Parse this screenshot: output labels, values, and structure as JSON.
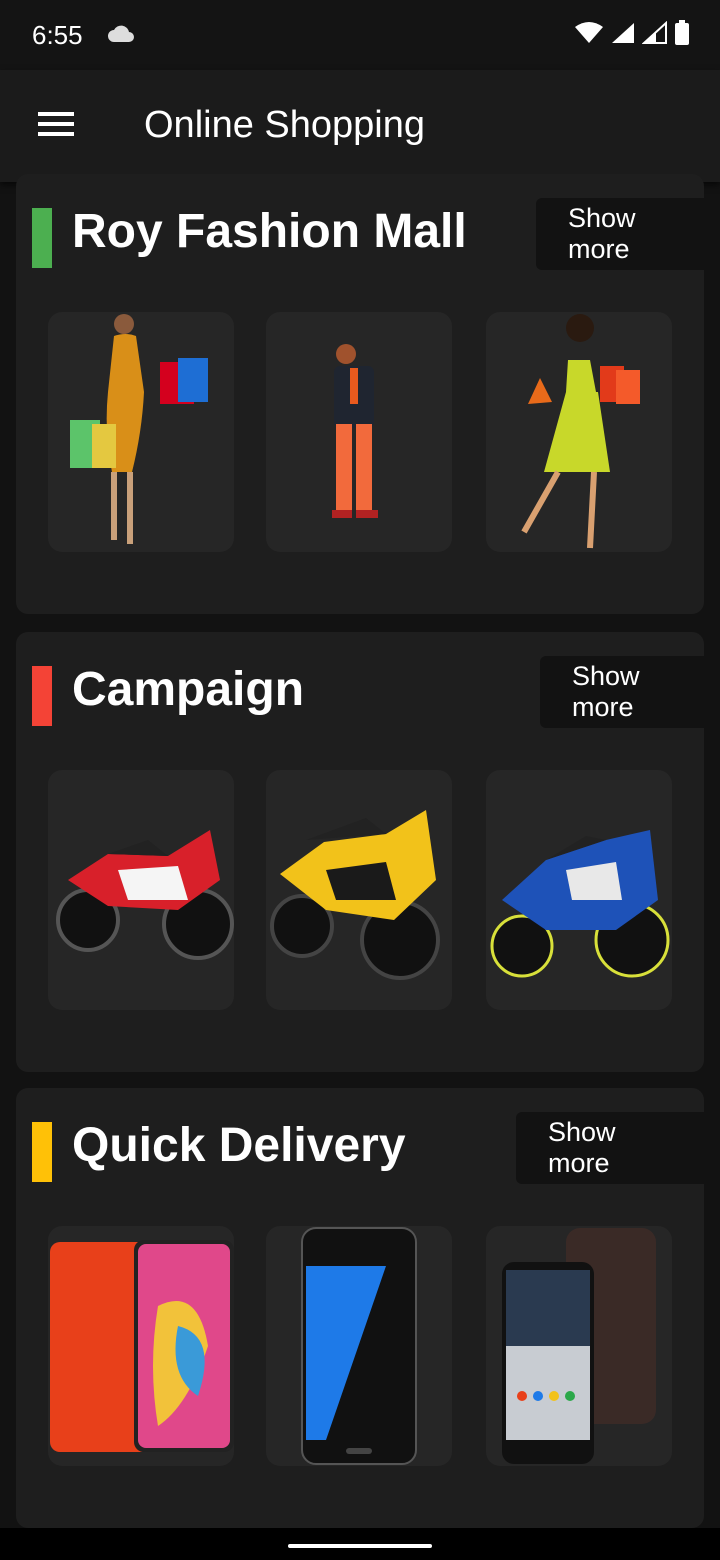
{
  "status": {
    "time": "6:55"
  },
  "app": {
    "title": "Online Shopping"
  },
  "sections": [
    {
      "title": "Roy Fashion Mall",
      "accent": "#4caf50",
      "more_label": "Show more",
      "items": [
        "woman-with-bags-orange",
        "man-thinking",
        "woman-with-bags-green"
      ]
    },
    {
      "title": "Campaign",
      "accent": "#f44336",
      "more_label": "Show more",
      "items": [
        "red-sport-motorcycle",
        "yellow-sport-motorcycle",
        "blue-sport-motorcycle"
      ]
    },
    {
      "title": "Quick Delivery",
      "accent": "#ffc107",
      "more_label": "Show more",
      "items": [
        "huawei-phone",
        "samsung-phone",
        "nokia-phone"
      ]
    }
  ]
}
